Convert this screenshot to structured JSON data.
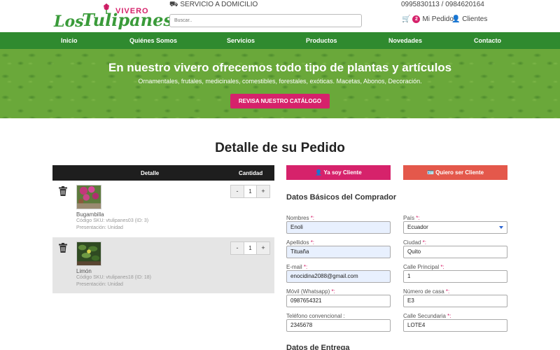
{
  "header": {
    "logo_los": "Los",
    "logo_tulipanes": "Tulipanes",
    "logo_vivero": "VIVERO",
    "delivery": "SERVICIO A DOMICILIO",
    "search_placeholder": "Buscar..",
    "phones": "0995830113 / 0984620164",
    "cart_count": "2",
    "cart_label": "Mi Pedido",
    "clients_label": "Clientes"
  },
  "nav": {
    "items": [
      "Inicio",
      "Quiénes Somos",
      "Servicios",
      "Productos",
      "Novedades",
      "Contacto"
    ]
  },
  "hero": {
    "title": "En nuestro vivero ofrecemos todo tipo de plantas y artículos",
    "subtitle": "Ornamentales, frutales, medicinales, comestibles, forestales, exóticas. Macetas, Abonos, Decoración.",
    "cta": "REVISA NUESTRO CATÁLOGO"
  },
  "page": {
    "title": "Detalle de su Pedido"
  },
  "order": {
    "col_detail": "Detalle",
    "col_qty": "Cantidad",
    "items": [
      {
        "name": "Bugambilla",
        "sku": "Código SKU: vtulipanes03 (ID: 3)",
        "presentation": "Presentación: Unidad",
        "qty": "1",
        "minus": "-",
        "plus": "+"
      },
      {
        "name": "Limón",
        "sku": "Código SKU: vtulipanes18 (ID: 18)",
        "presentation": "Presentación: Unidad",
        "qty": "1",
        "minus": "-",
        "plus": "+"
      }
    ]
  },
  "buttons": {
    "existing_client": "Ya soy Cliente",
    "new_client": "Quiero ser Cliente"
  },
  "form": {
    "section_basic": "Datos Básicos del Comprador",
    "section_delivery": "Datos de Entrega",
    "req": "*:",
    "nombres_label": "Nombres ",
    "nombres": "Enoli",
    "apellidos_label": "Apellidos ",
    "apellidos": "Tituaña",
    "email_label": "E-mail ",
    "email": "enocidina2088@gmail.com",
    "movil_label": "Móvil (Whatsapp) ",
    "movil": "0987654321",
    "telefono_label": "Teléfono convencional :",
    "telefono": "2345678",
    "pais_label": "País ",
    "pais": "Ecuador",
    "ciudad_label": "Ciudad ",
    "ciudad": "Quito",
    "calle_principal_label": "Calle Principal ",
    "calle_principal": "1",
    "numero_label": "Número de casa ",
    "numero": "E3",
    "calle_secundaria_label": "Calle Secundaria ",
    "calle_secundaria": "LOTE4"
  },
  "colors": {
    "brand_green": "#2f8a2f",
    "brand_pink": "#d6226b",
    "coral": "#e4584b"
  }
}
